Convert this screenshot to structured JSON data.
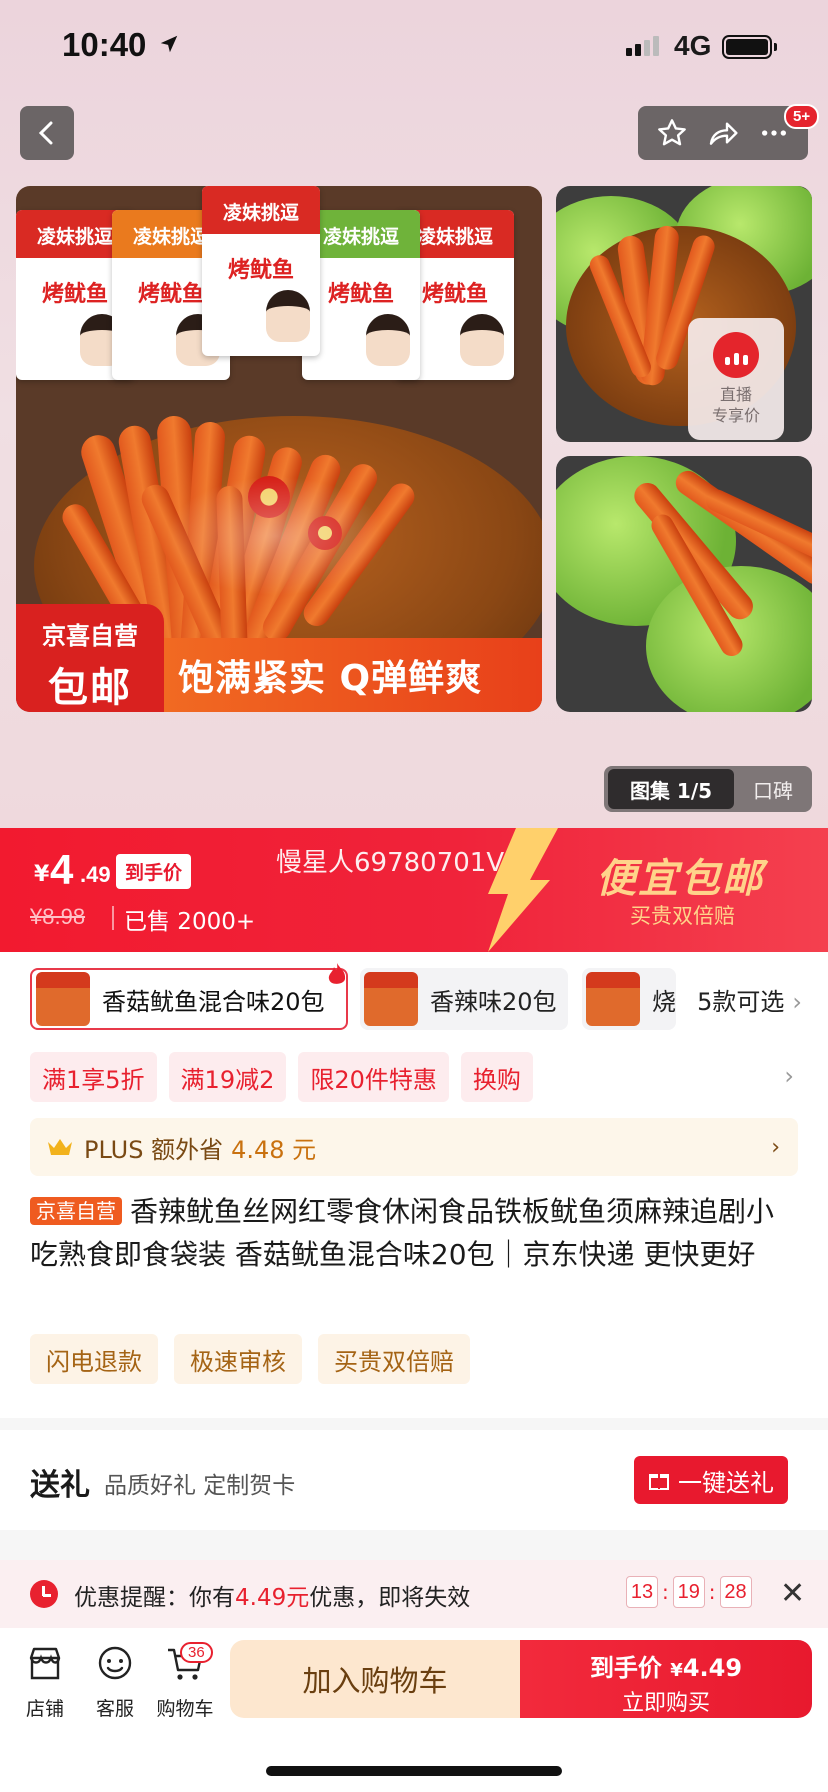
{
  "status_bar": {
    "time": "10:40",
    "network": "4G"
  },
  "top_bar": {
    "badge": "5+"
  },
  "gallery": {
    "packs": [
      {
        "brand": "凌妹挑逗",
        "name": "烤鱿鱼",
        "color": "#d92a23"
      },
      {
        "brand": "凌妹挑逗",
        "name": "烤鱿鱼",
        "color": "#ea7a1e"
      },
      {
        "brand": "凌妹挑逗",
        "name": "烤鱿鱼",
        "color": "#d92a23"
      },
      {
        "brand": "凌妹挑逗",
        "name": "烤鱿鱼",
        "color": "#6fb33a"
      },
      {
        "brand": "凌妹挑逗",
        "name": "烤鱿鱼",
        "color": "#d92a23"
      }
    ],
    "stamp_line1": "京喜自营",
    "stamp_line2": "包邮",
    "banner": "饱满紧实 Q弹鲜爽",
    "live_label1": "直播",
    "live_label2": "专享价",
    "pill_gallery": "图集 1/5",
    "pill_reviews": "口碑"
  },
  "price_bar": {
    "currency": "¥",
    "price_int": "4",
    "price_dec": ".49",
    "price_tag": "到手价",
    "old_price": "¥8.98",
    "sold": "已售 2000+",
    "user_id": "慢星人69780701V",
    "promo_title": "便宜包邮",
    "promo_sub": "买贵双倍赔"
  },
  "variants": [
    {
      "label": "香菇鱿鱼混合味20包",
      "selected": true
    },
    {
      "label": "香辣味20包",
      "selected": false
    },
    {
      "label": "烧",
      "selected": false
    }
  ],
  "variants_more": "5款可选",
  "promos": [
    "满1享5折",
    "满19减2",
    "限20件特惠",
    "换购"
  ],
  "plus": {
    "text": "PLUS 额外省",
    "value": "4.48 元"
  },
  "product": {
    "badge": "京喜自营",
    "title": "香辣鱿鱼丝网红零食休闲食品铁板鱿鱼须麻辣追剧小吃熟食即食袋装 香菇鱿鱼混合味20包｜京东快递 更快更好"
  },
  "services": [
    "闪电退款",
    "极速审核",
    "买贵双倍赔"
  ],
  "gift": {
    "title": "送礼",
    "subtitle": "品质好礼 定制贺卡",
    "button": "一键送礼"
  },
  "reminder": {
    "prefix": "优惠提醒：你有",
    "amount": "4.49元",
    "suffix": "优惠，即将失效",
    "h": "13",
    "m": "19",
    "s": "28"
  },
  "bottom_bar": {
    "shop": "店铺",
    "service": "客服",
    "cart": "购物车",
    "cart_count": "36",
    "add_cart": "加入购物车",
    "buy_line1": "到手价",
    "buy_currency": "¥",
    "buy_price": "4.49",
    "buy_line2": "立即购买"
  },
  "colors": {
    "brand_red": "#e8192e",
    "gold": "#ffd38a"
  }
}
